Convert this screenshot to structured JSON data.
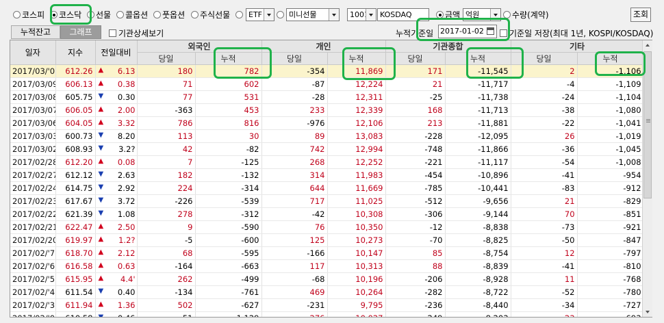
{
  "market_options": [
    {
      "label": "코스피",
      "selected": false
    },
    {
      "label": "코스닥",
      "selected": true
    },
    {
      "label": "선물",
      "selected": false
    },
    {
      "label": "콜옵션",
      "selected": false
    },
    {
      "label": "풋옵션",
      "selected": false
    },
    {
      "label": "주식선물",
      "selected": false
    }
  ],
  "etf_select": "ETF",
  "mini_select": "미니선물",
  "code_select": "1001",
  "code_name": "KOSDAQ",
  "unit": {
    "amount_label": "금액",
    "unit_select": "억원",
    "qty_label": "수량(계약)"
  },
  "query_button": "조회",
  "tabs": {
    "cumulative": "누적잔고",
    "graph": "그래프"
  },
  "institution_detail_label": "기관상세보기",
  "base_date_label": "누적기준일",
  "base_date_value": "2017-01-02",
  "save_base_label": "기준일 저장(최대 1년, KOSPI/KOSDAQ)",
  "headers": {
    "date": "일자",
    "index": "지수",
    "change": "전일대비",
    "groups": [
      "외국인",
      "개인",
      "기관종합",
      "기타"
    ],
    "daily": "당일",
    "cumulative": "누적"
  },
  "rows": [
    {
      "date": "2017/03/'0",
      "index": "612.26",
      "dir": "up",
      "chg": "6.13",
      "f_d": "180",
      "f_c": "782",
      "p_d": "-354",
      "p_c": "11,869",
      "i_d": "171",
      "i_c": "-11,545",
      "o_d": "2",
      "o_c": "-1,106"
    },
    {
      "date": "2017/03/09",
      "index": "606.13",
      "dir": "up",
      "chg": "0.38",
      "f_d": "71",
      "f_c": "602",
      "p_d": "-87",
      "p_c": "12,224",
      "i_d": "21",
      "i_c": "-11,717",
      "o_d": "-4",
      "o_c": "-1,109"
    },
    {
      "date": "2017/03/08",
      "index": "605.75",
      "dir": "dn",
      "chg": "0.30",
      "f_d": "77",
      "f_c": "531",
      "p_d": "-28",
      "p_c": "12,311",
      "i_d": "-25",
      "i_c": "-11,738",
      "o_d": "-24",
      "o_c": "-1,104"
    },
    {
      "date": "2017/03/07",
      "index": "606.05",
      "dir": "up",
      "chg": "2.00",
      "f_d": "-363",
      "f_c": "453",
      "p_d": "233",
      "p_c": "12,339",
      "i_d": "168",
      "i_c": "-11,713",
      "o_d": "-38",
      "o_c": "-1,080"
    },
    {
      "date": "2017/03/06",
      "index": "604.05",
      "dir": "up",
      "chg": "3.32",
      "f_d": "786",
      "f_c": "816",
      "p_d": "-976",
      "p_c": "12,106",
      "i_d": "213",
      "i_c": "-11,881",
      "o_d": "-22",
      "o_c": "-1,041"
    },
    {
      "date": "2017/03/03",
      "index": "600.73",
      "dir": "dn",
      "chg": "8.20",
      "f_d": "113",
      "f_c": "30",
      "p_d": "89",
      "p_c": "13,083",
      "i_d": "-228",
      "i_c": "-12,095",
      "o_d": "26",
      "o_c": "-1,019"
    },
    {
      "date": "2017/03/02",
      "index": "608.93",
      "dir": "dn",
      "chg": "3.2?",
      "f_d": "42",
      "f_c": "-82",
      "p_d": "742",
      "p_c": "12,994",
      "i_d": "-748",
      "i_c": "-11,866",
      "o_d": "-36",
      "o_c": "-1,045"
    },
    {
      "date": "2017/02/28",
      "index": "612.20",
      "dir": "up",
      "chg": "0.08",
      "f_d": "7",
      "f_c": "-125",
      "p_d": "268",
      "p_c": "12,252",
      "i_d": "-221",
      "i_c": "-11,117",
      "o_d": "-54",
      "o_c": "-1,008"
    },
    {
      "date": "2017/02/27",
      "index": "612.12",
      "dir": "dn",
      "chg": "2.63",
      "f_d": "182",
      "f_c": "-132",
      "p_d": "314",
      "p_c": "11,983",
      "i_d": "-454",
      "i_c": "-10,896",
      "o_d": "-41",
      "o_c": "-954"
    },
    {
      "date": "2017/02/24",
      "index": "614.75",
      "dir": "dn",
      "chg": "2.92",
      "f_d": "224",
      "f_c": "-314",
      "p_d": "644",
      "p_c": "11,669",
      "i_d": "-785",
      "i_c": "-10,441",
      "o_d": "-83",
      "o_c": "-912"
    },
    {
      "date": "2017/02/23",
      "index": "617.67",
      "dir": "dn",
      "chg": "3.72",
      "f_d": "-226",
      "f_c": "-539",
      "p_d": "717",
      "p_c": "11,025",
      "i_d": "-512",
      "i_c": "-9,656",
      "o_d": "21",
      "o_c": "-829"
    },
    {
      "date": "2017/02/22",
      "index": "621.39",
      "dir": "dn",
      "chg": "1.08",
      "f_d": "278",
      "f_c": "-312",
      "p_d": "-42",
      "p_c": "10,308",
      "i_d": "-306",
      "i_c": "-9,144",
      "o_d": "70",
      "o_c": "-851"
    },
    {
      "date": "2017/02/21",
      "index": "622.47",
      "dir": "up",
      "chg": "2.50",
      "f_d": "9",
      "f_c": "-590",
      "p_d": "76",
      "p_c": "10,350",
      "i_d": "-12",
      "i_c": "-8,838",
      "o_d": "-73",
      "o_c": "-921"
    },
    {
      "date": "2017/02/20",
      "index": "619.97",
      "dir": "up",
      "chg": "1.2?",
      "f_d": "-5",
      "f_c": "-600",
      "p_d": "125",
      "p_c": "10,273",
      "i_d": "-70",
      "i_c": "-8,825",
      "o_d": "-50",
      "o_c": "-847"
    },
    {
      "date": "2017/02/'7",
      "index": "618.70",
      "dir": "up",
      "chg": "2.12",
      "f_d": "68",
      "f_c": "-595",
      "p_d": "-166",
      "p_c": "10,147",
      "i_d": "85",
      "i_c": "-8,754",
      "o_d": "12",
      "o_c": "-797"
    },
    {
      "date": "2017/02/'6",
      "index": "616.58",
      "dir": "up",
      "chg": "0.63",
      "f_d": "-164",
      "f_c": "-663",
      "p_d": "117",
      "p_c": "10,313",
      "i_d": "88",
      "i_c": "-8,839",
      "o_d": "-41",
      "o_c": "-810"
    },
    {
      "date": "2017/02/'5",
      "index": "615.95",
      "dir": "up",
      "chg": "4.4'",
      "f_d": "262",
      "f_c": "-499",
      "p_d": "-68",
      "p_c": "10,196",
      "i_d": "-206",
      "i_c": "-8,928",
      "o_d": "11",
      "o_c": "-768"
    },
    {
      "date": "2017/02/'4",
      "index": "611.54",
      "dir": "dn",
      "chg": "0.40",
      "f_d": "-134",
      "f_c": "-761",
      "p_d": "469",
      "p_c": "10,264",
      "i_d": "-282",
      "i_c": "-8,722",
      "o_d": "-52",
      "o_c": "-780"
    },
    {
      "date": "2017/02/'3",
      "index": "611.94",
      "dir": "up",
      "chg": "1.36",
      "f_d": "502",
      "f_c": "-627",
      "p_d": "-231",
      "p_c": "9,795",
      "i_d": "-236",
      "i_c": "-8,440",
      "o_d": "-34",
      "o_c": "-727"
    },
    {
      "date": "2017/02/'0",
      "index": "610.58",
      "dir": "dn",
      "chg": "0.46",
      "f_d": "-51",
      "f_c": "-1,129",
      "p_d": "276",
      "p_c": "10,027",
      "i_d": "-249",
      "i_c": "-8,203",
      "o_d": "23",
      "o_c": "-693"
    }
  ],
  "colors": {
    "up": "#d2001e",
    "down": "#1a3fb0",
    "highlight": "#1fb24a",
    "selected_row": "#fbf4cc"
  }
}
